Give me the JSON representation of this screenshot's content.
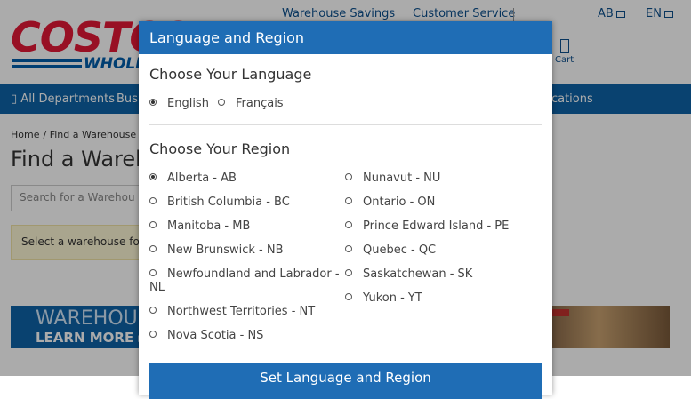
{
  "header": {
    "links": [
      "Warehouse Savings",
      "Customer Service",
      "AB",
      "EN"
    ],
    "cart_label": "Cart",
    "logo_text": "COSTCO",
    "logo_sub": "WHOLESALE"
  },
  "nav": {
    "all_departments": "All Departments",
    "business": "Bus",
    "locations": "ocations"
  },
  "page": {
    "breadcrumb": [
      "Home",
      "Find a Warehouse"
    ],
    "title": "Find a Wareh",
    "search_placeholder": "Search for a Warehou",
    "notice": "Select a warehouse fo",
    "banner_line1": "WAREHOUS",
    "banner_line2": "LEARN MORE ▸"
  },
  "modal": {
    "title": "Language and Region",
    "language_heading": "Choose Your Language",
    "languages": [
      {
        "label": "English",
        "selected": true
      },
      {
        "label": "Français",
        "selected": false
      }
    ],
    "region_heading": "Choose Your Region",
    "regions_left": [
      {
        "label": "Alberta - AB",
        "selected": true
      },
      {
        "label": "British Columbia - BC",
        "selected": false
      },
      {
        "label": "Manitoba - MB",
        "selected": false
      },
      {
        "label": "New Brunswick - NB",
        "selected": false
      },
      {
        "label": "Newfoundland and Labrador -",
        "selected": false
      },
      {
        "label": "Northwest Territories - NT",
        "selected": false
      },
      {
        "label": "Nova Scotia - NS",
        "selected": false
      }
    ],
    "nl_continuation": "NL",
    "regions_right": [
      {
        "label": "Nunavut - NU",
        "selected": false
      },
      {
        "label": "Ontario - ON",
        "selected": false
      },
      {
        "label": "Prince Edward Island - PE",
        "selected": false
      },
      {
        "label": "Quebec - QC",
        "selected": false
      },
      {
        "label": "Saskatchewan - SK",
        "selected": false
      },
      {
        "label": "Yukon - YT",
        "selected": false
      }
    ],
    "submit_label": "Set Language and Region"
  },
  "colors": {
    "brand_blue": "#1f6db5",
    "nav_blue": "#0e63a8",
    "logo_red": "#e31837"
  }
}
